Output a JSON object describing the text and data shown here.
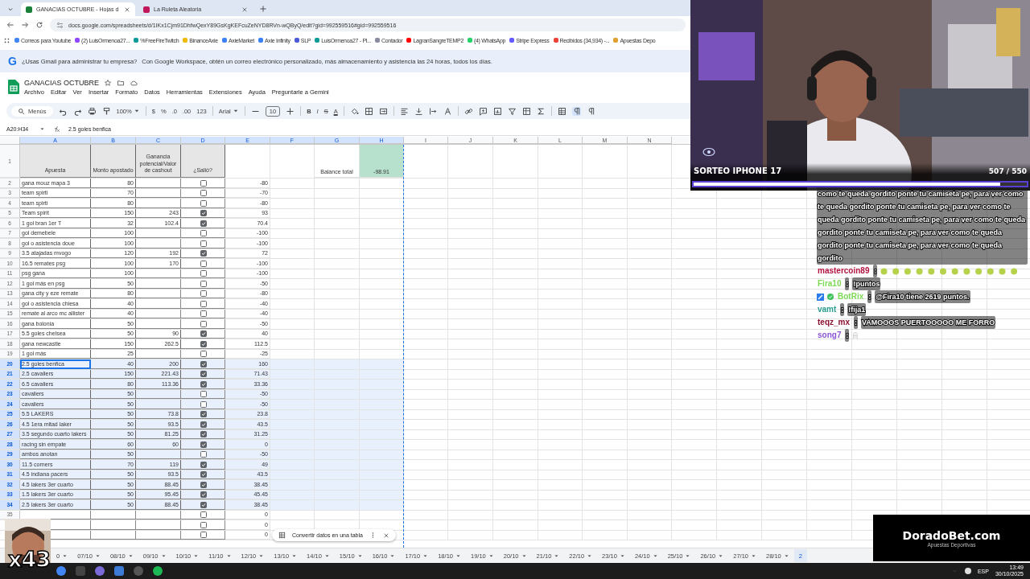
{
  "browser": {
    "tabs": [
      {
        "title": "GANACIAS OCTUBRE - Hojas d",
        "selected": true
      },
      {
        "title": "La Ruleta Aleatoria",
        "selected": false
      }
    ],
    "url": "docs.google.com/spreadsheets/d/1IKx1Cjm91DhfwQexY89GsKgKEFcuZeNYD8RVn-wQByQ/edit?gid=992559516#gid=992559516",
    "bookmarks": [
      {
        "label": "Correos para Youtube",
        "color": "#4285f4"
      },
      {
        "label": "(2) LuisOrmenoa27...",
        "color": "#9146ff"
      },
      {
        "label": "%FreeFireTwitch",
        "color": "#0a9a9a"
      },
      {
        "label": "BinanceAxie",
        "color": "#f0b90b"
      },
      {
        "label": "AxieMarket",
        "color": "#3b82f6"
      },
      {
        "label": "Axie Infinity",
        "color": "#3b82f6"
      },
      {
        "label": "SLP",
        "color": "#4a5ad8"
      },
      {
        "label": "LuisOrmenoa27 - Pl...",
        "color": "#0a9a9a"
      },
      {
        "label": "Contador",
        "color": "#8a8aa0"
      },
      {
        "label": "LagranSangreTEMP2",
        "color": "#ff0000"
      },
      {
        "label": "(4) WhatsApp",
        "color": "#25d366"
      },
      {
        "label": "Stripe Express",
        "color": "#635bff"
      },
      {
        "label": "Recibidos (34,934) -...",
        "color": "#ea4335"
      },
      {
        "label": "Apuestas Depo",
        "color": "#e0a030"
      }
    ]
  },
  "banner": {
    "logo": "G",
    "question": "¿Usas Gmail para administrar tu empresa?",
    "text": "Con Google Workspace, obtén un correo electrónico personalizado, más almacenamiento y asistencia las 24 horas, todos los días."
  },
  "doc": {
    "title": "GANACIAS OCTUBRE",
    "menu": [
      "Archivo",
      "Editar",
      "Ver",
      "Insertar",
      "Formato",
      "Datos",
      "Herramientas",
      "Extensiones",
      "Ayuda",
      "Preguntarle a Gemini"
    ]
  },
  "toolbar": {
    "texts": [
      "Menús",
      "100%",
      "$",
      "%",
      ".0",
      ".00",
      "123",
      "Arial",
      "10",
      "B",
      "I",
      "S",
      "A"
    ]
  },
  "formula_bar": {
    "name_box": "A20:H34",
    "value": "2.5 goles benfica"
  },
  "sheet": {
    "columns": [
      {
        "label": "A",
        "selected": true
      },
      {
        "label": "B",
        "selected": true
      },
      {
        "label": "C",
        "selected": true
      },
      {
        "label": "D",
        "selected": true
      },
      {
        "label": "E",
        "selected": true
      },
      {
        "label": "F",
        "selected": true
      },
      {
        "label": "G",
        "selected": true
      },
      {
        "label": "H",
        "selected": true
      },
      {
        "label": "I",
        "selected": false
      },
      {
        "label": "J",
        "selected": false
      },
      {
        "label": "K",
        "selected": false
      },
      {
        "label": "L",
        "selected": false
      },
      {
        "label": "M",
        "selected": false
      },
      {
        "label": "N",
        "selected": false
      }
    ],
    "header_row": {
      "num": "1",
      "a": "Apuesta",
      "b": "Monto apostado",
      "c": "Ganancia potencial/Valor de cashout",
      "d": "¿Salió?",
      "g": "Balance total",
      "h": "-98.91"
    },
    "rows": [
      {
        "num": "2",
        "a": "gana mouz mapa 3",
        "b": "80",
        "checked": false,
        "e": "-80",
        "selected": false,
        "focused": false
      },
      {
        "num": "3",
        "a": "team spirti",
        "b": "70",
        "checked": false,
        "e": "-70",
        "selected": false,
        "focused": false
      },
      {
        "num": "4",
        "a": "team spirti",
        "b": "80",
        "checked": false,
        "e": "-80",
        "selected": false,
        "focused": false
      },
      {
        "num": "5",
        "a": "Team spirit",
        "b": "150",
        "c": "243",
        "checked": true,
        "e": "93",
        "selected": false,
        "focused": false
      },
      {
        "num": "6",
        "a": "1 gol bran 1er T",
        "b": "32",
        "c": "102.4",
        "checked": true,
        "e": "70.4",
        "selected": false,
        "focused": false
      },
      {
        "num": "7",
        "a": "gol demebele",
        "b": "100",
        "checked": false,
        "e": "-100",
        "selected": false,
        "focused": false
      },
      {
        "num": "8",
        "a": "gol o asistencia doue",
        "b": "100",
        "checked": false,
        "e": "-100",
        "selected": false,
        "focused": false
      },
      {
        "num": "9",
        "a": "3.5 atajadas mvogo",
        "b": "120",
        "c": "192",
        "checked": true,
        "e": "72",
        "selected": false,
        "focused": false
      },
      {
        "num": "10",
        "a": "16.5 remates psg",
        "b": "100",
        "c": "170",
        "checked": false,
        "e": "-100",
        "selected": false,
        "focused": false
      },
      {
        "num": "11",
        "a": "psg gana",
        "b": "100",
        "checked": false,
        "e": "-100",
        "selected": false,
        "focused": false
      },
      {
        "num": "12",
        "a": "1 gol más en psg",
        "b": "50",
        "checked": false,
        "e": "-50",
        "selected": false,
        "focused": false
      },
      {
        "num": "13",
        "a": "gana city y eze remate",
        "b": "80",
        "checked": false,
        "e": "-80",
        "selected": false,
        "focused": false
      },
      {
        "num": "14",
        "a": "gol o asistencia chiesa",
        "b": "40",
        "checked": false,
        "e": "-40",
        "selected": false,
        "focused": false
      },
      {
        "num": "15",
        "a": "remate al arco mc allister",
        "b": "40",
        "checked": false,
        "e": "-40",
        "selected": false,
        "focused": false
      },
      {
        "num": "16",
        "a": "gana bolonia",
        "b": "50",
        "checked": false,
        "e": "-50",
        "selected": false,
        "focused": false
      },
      {
        "num": "17",
        "a": "5.5 goles chelsea",
        "b": "50",
        "c": "90",
        "checked": true,
        "e": "40",
        "selected": false,
        "focused": false
      },
      {
        "num": "18",
        "a": "gana newcastle",
        "b": "150",
        "c": "262.5",
        "checked": true,
        "e": "112.5",
        "selected": false,
        "focused": false
      },
      {
        "num": "19",
        "a": "1 gol más",
        "b": "25",
        "checked": false,
        "e": "-25",
        "selected": false,
        "focused": false
      },
      {
        "num": "20",
        "a": "2.5 goles benfica",
        "b": "40",
        "c": "200",
        "checked": true,
        "e": "160",
        "selected": true,
        "focused": true
      },
      {
        "num": "21",
        "a": "2.5 cavaliers",
        "b": "150",
        "c": "221.43",
        "checked": true,
        "e": "71.43",
        "selected": true,
        "focused": false
      },
      {
        "num": "22",
        "a": "6.5 cavaliers",
        "b": "80",
        "c": "113.36",
        "checked": true,
        "e": "33.36",
        "selected": true,
        "focused": false
      },
      {
        "num": "23",
        "a": "cavaliers",
        "b": "50",
        "checked": false,
        "e": "-50",
        "selected": true,
        "focused": false
      },
      {
        "num": "24",
        "a": "cavaliers",
        "b": "50",
        "checked": false,
        "e": "-50",
        "selected": true,
        "focused": false
      },
      {
        "num": "25",
        "a": "5.5 LAKERS",
        "b": "50",
        "c": "73.8",
        "checked": true,
        "e": "23.8",
        "selected": true,
        "focused": false
      },
      {
        "num": "26",
        "a": "4.5 1era mitad laker",
        "b": "50",
        "c": "93.5",
        "checked": true,
        "e": "43.5",
        "selected": true,
        "focused": false
      },
      {
        "num": "27",
        "a": "3.5 segundo cuarto lakers",
        "b": "50",
        "c": "81.25",
        "checked": true,
        "e": "31.25",
        "selected": true,
        "focused": false
      },
      {
        "num": "28",
        "a": "racing sin empate",
        "b": "60",
        "c": "60",
        "checked": true,
        "e": "0",
        "selected": true,
        "focused": false
      },
      {
        "num": "29",
        "a": "ambos anotan",
        "b": "50",
        "checked": false,
        "e": "-50",
        "selected": true,
        "focused": false
      },
      {
        "num": "30",
        "a": "11.5 corners",
        "b": "70",
        "c": "119",
        "checked": true,
        "e": "49",
        "selected": true,
        "focused": false
      },
      {
        "num": "31",
        "a": "4.5 indiana pacers",
        "b": "50",
        "c": "93.5",
        "checked": true,
        "e": "43.5",
        "selected": true,
        "focused": false
      },
      {
        "num": "32",
        "a": "4.5 lakers 3er cuarto",
        "b": "50",
        "c": "88.45",
        "checked": true,
        "e": "38.45",
        "selected": true,
        "focused": false
      },
      {
        "num": "33",
        "a": "1.5 lakers 3er cuarto",
        "b": "50",
        "c": "95.45",
        "checked": true,
        "e": "45.45",
        "selected": true,
        "focused": false
      },
      {
        "num": "34",
        "a": "2.5 lakers 3er cuarto",
        "b": "50",
        "c": "88.45",
        "checked": true,
        "e": "38.45",
        "selected": true,
        "focused": false
      },
      {
        "num": "35",
        "checked": false,
        "e": "0",
        "selected": false
      },
      {
        "checked": false,
        "e": "0",
        "selected": false
      },
      {
        "checked": false,
        "e": "0",
        "selected": false
      }
    ],
    "tabs": [
      {
        "label": "0",
        "selected": false
      },
      {
        "label": "07/10",
        "selected": false
      },
      {
        "label": "08/10",
        "selected": false
      },
      {
        "label": "09/10",
        "selected": false
      },
      {
        "label": "10/10",
        "selected": false
      },
      {
        "label": "11/10",
        "selected": false
      },
      {
        "label": "12/10",
        "selected": false
      },
      {
        "label": "13/10",
        "selected": false
      },
      {
        "label": "14/10",
        "selected": false
      },
      {
        "label": "15/10",
        "selected": false
      },
      {
        "label": "16/10",
        "selected": false
      },
      {
        "label": "17/10",
        "selected": false
      },
      {
        "label": "18/10",
        "selected": false
      },
      {
        "label": "19/10",
        "selected": false
      },
      {
        "label": "20/10",
        "selected": false
      },
      {
        "label": "21/10",
        "selected": false
      },
      {
        "label": "22/10",
        "selected": false
      },
      {
        "label": "23/10",
        "selected": false
      },
      {
        "label": "24/10",
        "selected": false
      },
      {
        "label": "25/10",
        "selected": false
      },
      {
        "label": "26/10",
        "selected": false
      },
      {
        "label": "27/10",
        "selected": false
      },
      {
        "label": "28/10",
        "selected": false
      },
      {
        "label": "2",
        "selected": true
      }
    ],
    "toast": {
      "text": "Convertir datos en una tabla"
    }
  },
  "stream": {
    "giveaway": {
      "title": "SORTEO IPHONE 17",
      "count": "507 / 550",
      "level": 0.92
    },
    "chat": [
      {
        "kind": "text",
        "text": "como te queda gordito ponte tu camiseta pe, para ver como te queda gordito ponte tu camiseta pe, para ver como te queda gordito ponte tu camiseta pe, para ver como te queda gordito ponte tu camiseta pe, para ver como te queda gordito ponte tu camiseta pe, para ver como te queda gordito"
      },
      {
        "kind": "emotes",
        "user": "mastercoin89",
        "sep": ":",
        "color": "#b3123f"
      },
      {
        "kind": "text",
        "user": "Fira10",
        "sep": ":",
        "color": "#7ed957",
        "text": "!puntos"
      },
      {
        "kind": "bot",
        "user": "BotRix",
        "sep": ":",
        "color": "#7ed957",
        "text": "@Fira10 tiene 2619 puntos."
      },
      {
        "kind": "text",
        "user": "vamt",
        "sep": ":",
        "color": "#2a9d8f",
        "text": "!fija1"
      },
      {
        "kind": "text",
        "user": "teqz_mx",
        "sep": ":",
        "color": "#8c0f2e",
        "text": "VAMOOOS PUERTOOOOO ME FORRO"
      },
      {
        "kind": "emote",
        "user": "song7",
        "sep": ":",
        "color": "#8b55d6"
      }
    ],
    "sponsor": {
      "name": "DoradoBet.com",
      "tagline": "Apuestas Deportivas"
    },
    "meme": {
      "caption": "x43"
    }
  },
  "taskbar": {
    "language": "ESP",
    "time": "13:49",
    "date": "30/10/2025"
  }
}
